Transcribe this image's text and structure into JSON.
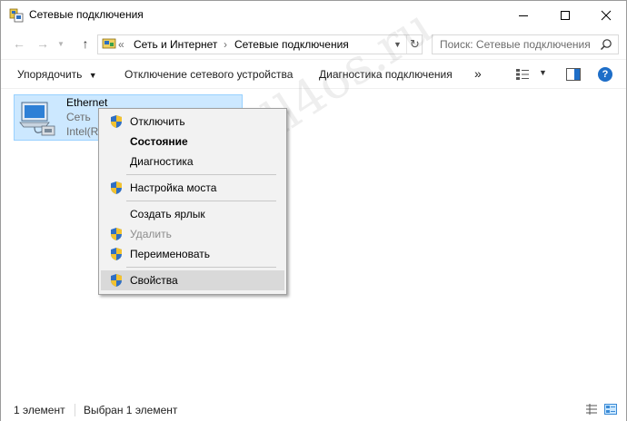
{
  "window": {
    "title": "Сетевые подключения",
    "controls": {
      "minimize_icon": "minimize-icon",
      "maximize_icon": "maximize-icon",
      "close_icon": "close-icon"
    }
  },
  "address_bar": {
    "overflow": "«",
    "crumbs": [
      "Сеть и Интернет",
      "Сетевые подключения"
    ],
    "separator": "›",
    "search_placeholder": "Поиск: Сетевые подключения"
  },
  "command_bar": {
    "organize": "Упорядочить",
    "disable_device": "Отключение сетевого устройства",
    "diagnostics": "Диагностика подключения",
    "more": "»"
  },
  "connection": {
    "name": "Ethernet",
    "status": "Сеть",
    "adapter": "Intel(R"
  },
  "context_menu": {
    "items": [
      {
        "label": "Отключить",
        "shield": true
      },
      {
        "label": "Состояние",
        "bold": true
      },
      {
        "label": "Диагностика"
      },
      {
        "label": "Настройка моста",
        "shield": true
      },
      {
        "label": "Создать ярлык"
      },
      {
        "label": "Удалить",
        "shield": true,
        "disabled": true
      },
      {
        "label": "Переименовать",
        "shield": true
      },
      {
        "label": "Свойства",
        "shield": true,
        "highlighted": true
      }
    ]
  },
  "status_bar": {
    "count": "1 элемент",
    "selected": "Выбран 1 элемент"
  },
  "watermark": "All4os.ru",
  "colors": {
    "selection_bg": "#cce8ff",
    "selection_border": "#99d1ff",
    "menu_bg": "#f2f2f2",
    "help_blue": "#1e6ec8"
  }
}
